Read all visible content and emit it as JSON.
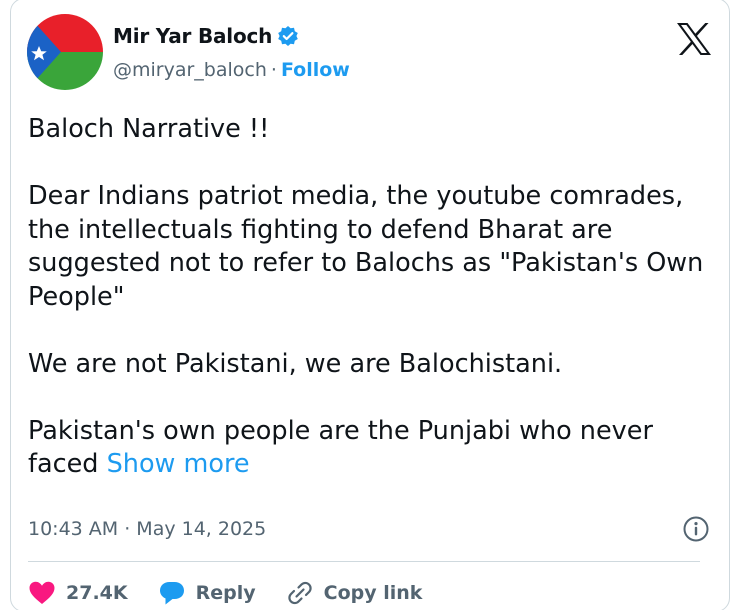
{
  "author": {
    "name": "Mir Yar Baloch",
    "handle": "@miryar_baloch",
    "separator": "·",
    "follow_label": "Follow",
    "avatar_icon": "baloch-flag-avatar",
    "verified_icon": "verified-badge-icon"
  },
  "platform_logo": "x-logo-icon",
  "tweet": {
    "paragraphs": [
      "Baloch Narrative !!",
      "Dear Indians patriot media, the youtube comrades, the intellectuals fighting to defend Bharat are suggested not to refer to Balochs as \"Pakistan's Own People\"",
      "We are not Pakistani, we are Balochistani.",
      "Pakistan's own people are the Punjabi who never faced"
    ],
    "show_more_label": "Show more"
  },
  "timestamp": "10:43 AM · May 14, 2025",
  "actions": {
    "like_count": "27.4K",
    "reply_label": "Reply",
    "copy_link_label": "Copy link"
  },
  "colors": {
    "accent": "#1d9bf0",
    "like": "#f91880",
    "muted_text": "#536471",
    "text": "#0f1419",
    "border": "#cfd9de"
  }
}
